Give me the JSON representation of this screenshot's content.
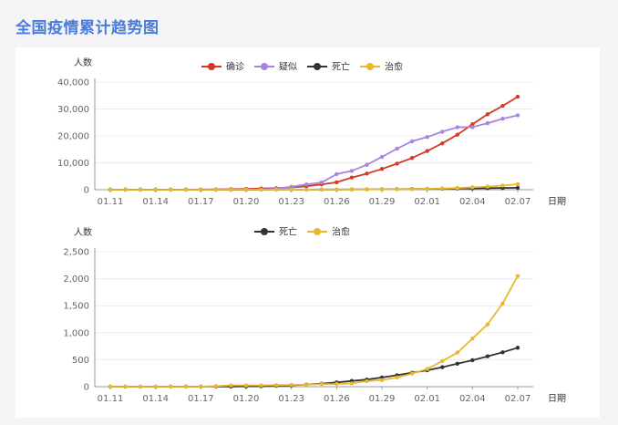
{
  "page": {
    "title": "全国疫情累计趋势图"
  },
  "chart_data": [
    {
      "type": "line",
      "ylabel": "人数",
      "xlabel": "日期",
      "ylim": [
        0,
        40000
      ],
      "yticks": [
        0,
        10000,
        20000,
        30000,
        40000
      ],
      "ytick_labels": [
        "0",
        "10,000",
        "20,000",
        "30,000",
        "40,000"
      ],
      "x": [
        "01.11",
        "01.12",
        "01.13",
        "01.14",
        "01.15",
        "01.16",
        "01.17",
        "01.18",
        "01.19",
        "01.20",
        "01.21",
        "01.22",
        "01.23",
        "01.24",
        "01.25",
        "01.26",
        "01.27",
        "01.28",
        "01.29",
        "01.30",
        "01.31",
        "02.01",
        "02.02",
        "02.03",
        "02.04",
        "02.05",
        "02.06",
        "02.07"
      ],
      "xtick_labels": [
        "01.11",
        "01.14",
        "01.17",
        "01.20",
        "01.23",
        "01.26",
        "01.29",
        "02.01",
        "02.04",
        "02.07"
      ],
      "grid": true,
      "legend": "top",
      "series": [
        {
          "name": "确诊",
          "color": "#d23a26",
          "values": [
            41,
            41,
            41,
            41,
            41,
            45,
            62,
            121,
            198,
            291,
            440,
            571,
            830,
            1287,
            1975,
            2744,
            4515,
            5974,
            7711,
            9692,
            11791,
            14380,
            17205,
            20438,
            24324,
            28018,
            31161,
            34546
          ]
        },
        {
          "name": "疑似",
          "color": "#a784e0",
          "values": [
            0,
            0,
            0,
            0,
            0,
            0,
            0,
            0,
            0,
            54,
            37,
            393,
            1072,
            1965,
            2684,
            5794,
            6973,
            9239,
            12167,
            15238,
            17988,
            19544,
            21558,
            23214,
            23260,
            24702,
            26359,
            27657
          ]
        },
        {
          "name": "死亡",
          "color": "#333333",
          "values": [
            1,
            1,
            1,
            1,
            2,
            2,
            2,
            3,
            3,
            6,
            9,
            17,
            25,
            41,
            56,
            80,
            106,
            132,
            170,
            213,
            259,
            304,
            361,
            425,
            490,
            563,
            636,
            722
          ]
        },
        {
          "name": "治愈",
          "color": "#e8b92e",
          "values": [
            0,
            0,
            0,
            0,
            0,
            0,
            0,
            10,
            25,
            25,
            25,
            28,
            34,
            38,
            49,
            51,
            60,
            103,
            124,
            171,
            243,
            328,
            475,
            632,
            892,
            1153,
            1540,
            2050
          ]
        }
      ]
    },
    {
      "type": "line",
      "ylabel": "人数",
      "xlabel": "日期",
      "ylim": [
        0,
        2500
      ],
      "yticks": [
        0,
        500,
        1000,
        1500,
        2000,
        2500
      ],
      "ytick_labels": [
        "0",
        "500",
        "1,000",
        "1,500",
        "2,000",
        "2,500"
      ],
      "x": [
        "01.11",
        "01.12",
        "01.13",
        "01.14",
        "01.15",
        "01.16",
        "01.17",
        "01.18",
        "01.19",
        "01.20",
        "01.21",
        "01.22",
        "01.23",
        "01.24",
        "01.25",
        "01.26",
        "01.27",
        "01.28",
        "01.29",
        "01.30",
        "01.31",
        "02.01",
        "02.02",
        "02.03",
        "02.04",
        "02.05",
        "02.06",
        "02.07"
      ],
      "xtick_labels": [
        "01.11",
        "01.14",
        "01.17",
        "01.20",
        "01.23",
        "01.26",
        "01.29",
        "02.01",
        "02.04",
        "02.07"
      ],
      "grid": true,
      "legend": "top",
      "series": [
        {
          "name": "死亡",
          "color": "#333333",
          "values": [
            1,
            1,
            1,
            1,
            2,
            2,
            2,
            3,
            3,
            6,
            9,
            17,
            25,
            41,
            56,
            80,
            106,
            132,
            170,
            213,
            259,
            304,
            361,
            425,
            490,
            563,
            636,
            722
          ]
        },
        {
          "name": "治愈",
          "color": "#e8b92e",
          "values": [
            0,
            0,
            0,
            0,
            0,
            0,
            0,
            10,
            25,
            25,
            25,
            28,
            34,
            38,
            49,
            51,
            60,
            103,
            124,
            171,
            243,
            328,
            475,
            632,
            892,
            1153,
            1540,
            2050
          ]
        }
      ]
    }
  ]
}
